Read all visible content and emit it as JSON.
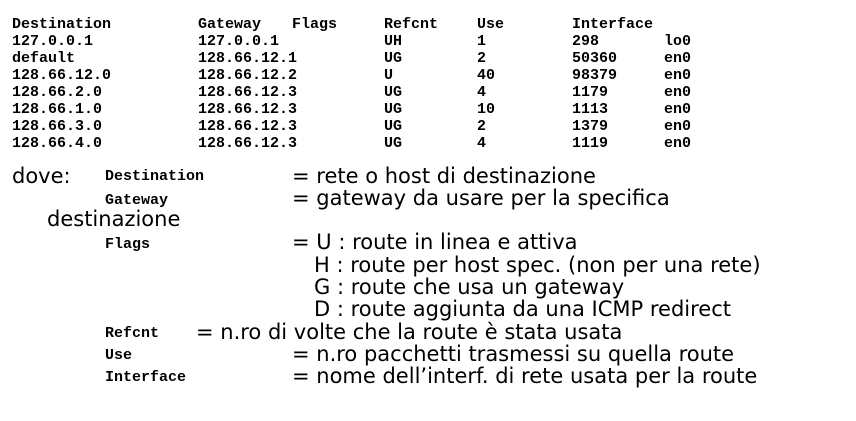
{
  "routing_table": {
    "headers": [
      "Destination",
      "Gateway",
      "Flags",
      "Refcnt",
      "Use",
      "Interface",
      ""
    ],
    "rows": [
      [
        "127.0.0.1",
        "127.0.0.1",
        "",
        "UH",
        "1",
        "298",
        "lo0"
      ],
      [
        "default",
        "128.66.12.1",
        "",
        "UG",
        "2",
        "50360",
        "en0"
      ],
      [
        "128.66.12.0",
        "128.66.12.2",
        "",
        "U",
        "40",
        "98379",
        "en0"
      ],
      [
        "128.66.2.0",
        "128.66.12.3",
        "",
        "UG",
        "4",
        "1179",
        "en0"
      ],
      [
        "128.66.1.0",
        "128.66.12.3",
        "",
        "UG",
        "10",
        "1113",
        "en0"
      ],
      [
        "128.66.3.0",
        "128.66.12.3",
        "",
        "UG",
        "2",
        "1379",
        "en0"
      ],
      [
        "128.66.4.0",
        "128.66.12.3",
        "",
        "UG",
        "4",
        "1119",
        "en0"
      ]
    ]
  },
  "legend": {
    "dove": "dove:",
    "destination_term": "Destination",
    "destination_desc": "= rete o host di destinazione",
    "gateway_term": "Gateway",
    "gateway_desc": "= gateway da usare per la specifica",
    "gateway_desc_cont": "destinazione",
    "flags_term": "Flags",
    "flags_desc_u": "= U : route in linea e attiva",
    "flags_desc_h": "H : route per host spec. (non per una rete)",
    "flags_desc_g": "G : route che usa un gateway",
    "flags_desc_d": "D : route aggiunta da una ICMP redirect",
    "refcnt_term": "Refcnt",
    "refcnt_desc": "= n.ro di volte che la route è stata usata",
    "use_term": "Use",
    "use_desc": "= n.ro pacchetti trasmessi su quella route",
    "interface_term": "Interface",
    "interface_desc": "= nome dell’interf. di rete usata per la route"
  }
}
